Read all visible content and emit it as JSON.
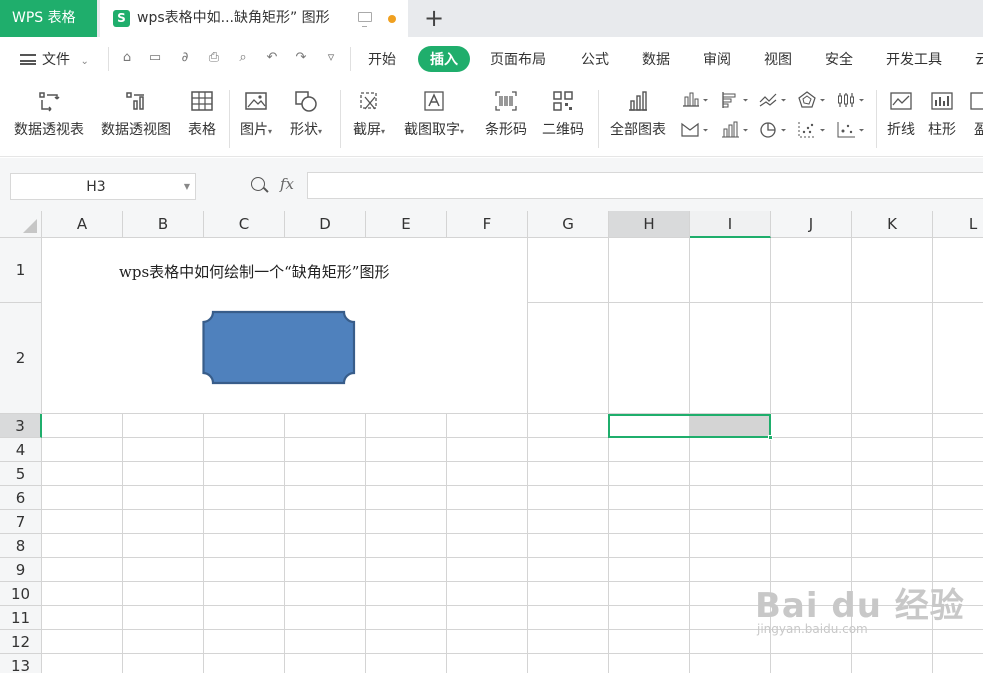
{
  "tabs": {
    "app_name": "WPS 表格",
    "doc_icon_letter": "S",
    "doc_title": "wps表格中如...缺角矩形” 图形",
    "new_tab": "+"
  },
  "menu": {
    "file": "文件",
    "tabs": [
      "开始",
      "插入",
      "页面布局",
      "公式",
      "数据",
      "审阅",
      "视图",
      "安全",
      "开发工具",
      "云"
    ],
    "active_tab": "插入"
  },
  "ribbon": {
    "pivot_table": "数据透视表",
    "pivot_chart": "数据透视图",
    "table": "表格",
    "picture": "图片",
    "shape": "形状",
    "screenshot": "截屏",
    "ocr": "截图取字",
    "barcode": "条形码",
    "qrcode": "二维码",
    "all_charts": "全部图表",
    "line": "折线",
    "column": "柱形",
    "more": "盈"
  },
  "formula_bar": {
    "name_box": "H3",
    "fx": "fx",
    "formula": ""
  },
  "sheet": {
    "columns": [
      "A",
      "B",
      "C",
      "D",
      "E",
      "F",
      "G",
      "H",
      "I",
      "J",
      "K",
      "L"
    ],
    "rows": [
      "1",
      "2",
      "3",
      "4",
      "5",
      "6",
      "7",
      "8",
      "9",
      "10",
      "11",
      "12",
      "13"
    ],
    "selected_cell": "H3",
    "selected_range": "H3:I3",
    "a1_text": "wps表格中如何绘制一个“缺角矩形”图形"
  },
  "shape": {
    "type": "snip-corner-rectangle",
    "fill": "#4f81bd",
    "stroke": "#385d8a"
  },
  "colors": {
    "accent": "#1fae6c",
    "header_bg": "#f5f6f7",
    "gridline": "#d4d4d4"
  },
  "watermark": {
    "brand": "Bai du 经验",
    "url": "jingyan.baidu.com"
  }
}
